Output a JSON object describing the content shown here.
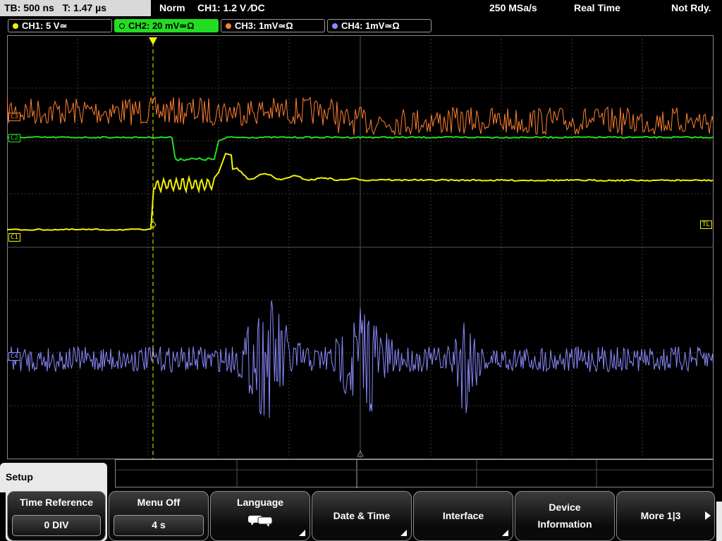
{
  "status": {
    "timebase": "TB: 500 ns",
    "trigger_pos": "T: 1.47 µs",
    "mode": "Norm",
    "trigger_info": "CH1: 1.2 V ∕DC",
    "sample_rate": "250 MSa/s",
    "acq_mode": "Real Time",
    "state": "Not Rdy."
  },
  "channels": [
    {
      "label": "CH1: 5 V≃",
      "color": "#f2f200",
      "active": false
    },
    {
      "label": "CH2: 20 mV≃Ω",
      "color": "#22dd22",
      "active": true
    },
    {
      "label": "CH3: 1mV≃Ω",
      "color": "#ff8030",
      "active": false
    },
    {
      "label": "CH4: 1mV≃Ω",
      "color": "#8a8aff",
      "active": false
    }
  ],
  "markers": {
    "c3": "C3",
    "c2": "C2",
    "c1": "C1",
    "c4": "C4",
    "tl": "TL",
    "trig": "T"
  },
  "menu": {
    "title": "Setup",
    "time_reference": {
      "label": "Time Reference",
      "value": "0 DIV"
    },
    "menu_off": {
      "label": "Menu Off",
      "value": "4 s"
    },
    "language": {
      "label": "Language",
      "icon": "speech-bubbles-icon"
    },
    "date_time": {
      "label": "Date & Time"
    },
    "interface": {
      "label": "Interface"
    },
    "device_info": {
      "label_line1": "Device",
      "label_line2": "Information"
    },
    "more": {
      "label": "More 1|3"
    }
  }
}
